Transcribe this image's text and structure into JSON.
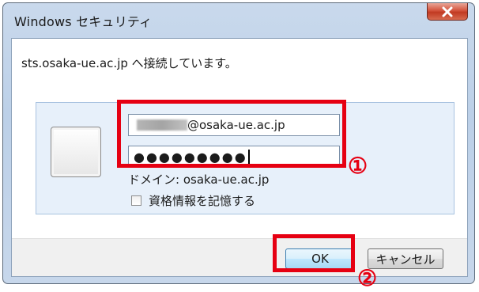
{
  "window": {
    "title": "Windows セキュリティ",
    "close_label": "x"
  },
  "dialog": {
    "message": "sts.osaka-ue.ac.jp へ接続しています。",
    "username_suffix": "@osaka-ue.ac.jp",
    "password_mask": "●●●●●●●●●",
    "domain_label": "ドメイン: osaka-ue.ac.jp",
    "remember_label": "資格情報を記憶する",
    "remember_checked": false
  },
  "buttons": {
    "ok_label": "OK",
    "cancel_label": "キャンセル"
  },
  "annotations": {
    "step1": "①",
    "step2": "②",
    "color": "#e60012"
  }
}
